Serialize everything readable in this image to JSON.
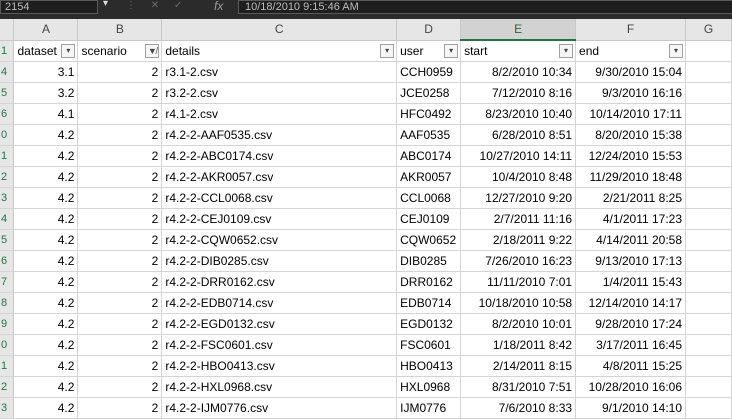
{
  "formula_bar": {
    "name_box": "2154",
    "formula_text": "10/18/2010 9:15:46 AM",
    "fx_label": "fx"
  },
  "columns": [
    "A",
    "B",
    "C",
    "D",
    "E",
    "F",
    "G"
  ],
  "selected_column": "E",
  "header_row": {
    "row_number": "1",
    "cells": [
      "dataset",
      "scenario",
      "details",
      "user",
      "start",
      "end"
    ],
    "filter_active": [
      false,
      true,
      false,
      false,
      false,
      false
    ]
  },
  "rows": [
    {
      "row": "4",
      "dataset": "3.1",
      "scenario": "2",
      "details": "r3.1-2.csv",
      "user": "CCH0959",
      "start": "8/2/2010 10:34",
      "end": "9/30/2010 15:04"
    },
    {
      "row": "5",
      "dataset": "3.2",
      "scenario": "2",
      "details": "r3.2-2.csv",
      "user": "JCE0258",
      "start": "7/12/2010 8:16",
      "end": "9/3/2010 16:16"
    },
    {
      "row": "6",
      "dataset": "4.1",
      "scenario": "2",
      "details": "r4.1-2.csv",
      "user": "HFC0492",
      "start": "8/23/2010 10:40",
      "end": "10/14/2010 17:11"
    },
    {
      "row": "0",
      "dataset": "4.2",
      "scenario": "2",
      "details": "r4.2-2-AAF0535.csv",
      "user": "AAF0535",
      "start": "6/28/2010 8:51",
      "end": "8/20/2010 15:38"
    },
    {
      "row": "1",
      "dataset": "4.2",
      "scenario": "2",
      "details": "r4.2-2-ABC0174.csv",
      "user": "ABC0174",
      "start": "10/27/2010 14:11",
      "end": "12/24/2010 15:53"
    },
    {
      "row": "2",
      "dataset": "4.2",
      "scenario": "2",
      "details": "r4.2-2-AKR0057.csv",
      "user": "AKR0057",
      "start": "10/4/2010 8:48",
      "end": "11/29/2010 18:48"
    },
    {
      "row": "3",
      "dataset": "4.2",
      "scenario": "2",
      "details": "r4.2-2-CCL0068.csv",
      "user": "CCL0068",
      "start": "12/27/2010 9:20",
      "end": "2/21/2011 8:25"
    },
    {
      "row": "4",
      "dataset": "4.2",
      "scenario": "2",
      "details": "r4.2-2-CEJ0109.csv",
      "user": "CEJ0109",
      "start": "2/7/2011 11:16",
      "end": "4/1/2011 17:23"
    },
    {
      "row": "5",
      "dataset": "4.2",
      "scenario": "2",
      "details": "r4.2-2-CQW0652.csv",
      "user": "CQW0652",
      "start": "2/18/2011 9:22",
      "end": "4/14/2011 20:58"
    },
    {
      "row": "6",
      "dataset": "4.2",
      "scenario": "2",
      "details": "r4.2-2-DIB0285.csv",
      "user": "DIB0285",
      "start": "7/26/2010 16:23",
      "end": "9/13/2010 17:13"
    },
    {
      "row": "7",
      "dataset": "4.2",
      "scenario": "2",
      "details": "r4.2-2-DRR0162.csv",
      "user": "DRR0162",
      "start": "11/11/2010 7:01",
      "end": "1/4/2011 15:43"
    },
    {
      "row": "8",
      "dataset": "4.2",
      "scenario": "2",
      "details": "r4.2-2-EDB0714.csv",
      "user": "EDB0714",
      "start": "10/18/2010 10:58",
      "end": "12/14/2010 14:17"
    },
    {
      "row": "9",
      "dataset": "4.2",
      "scenario": "2",
      "details": "r4.2-2-EGD0132.csv",
      "user": "EGD0132",
      "start": "8/2/2010 10:01",
      "end": "9/28/2010 17:24"
    },
    {
      "row": "0",
      "dataset": "4.2",
      "scenario": "2",
      "details": "r4.2-2-FSC0601.csv",
      "user": "FSC0601",
      "start": "1/18/2011 8:42",
      "end": "3/17/2011 16:45"
    },
    {
      "row": "1",
      "dataset": "4.2",
      "scenario": "2",
      "details": "r4.2-2-HBO0413.csv",
      "user": "HBO0413",
      "start": "2/14/2011 8:15",
      "end": "4/8/2011 15:25"
    },
    {
      "row": "2",
      "dataset": "4.2",
      "scenario": "2",
      "details": "r4.2-2-HXL0968.csv",
      "user": "HXL0968",
      "start": "8/31/2010 7:51",
      "end": "10/28/2010 16:06"
    },
    {
      "row": "3",
      "dataset": "4.2",
      "scenario": "2",
      "details": "r4.2-2-IJM0776.csv",
      "user": "IJM0776",
      "start": "7/6/2010 8:33",
      "end": "9/1/2010 14:10"
    }
  ],
  "icons": {
    "filter": "dropdown-arrow-icon",
    "filter_active": "funnel-filter-icon"
  }
}
